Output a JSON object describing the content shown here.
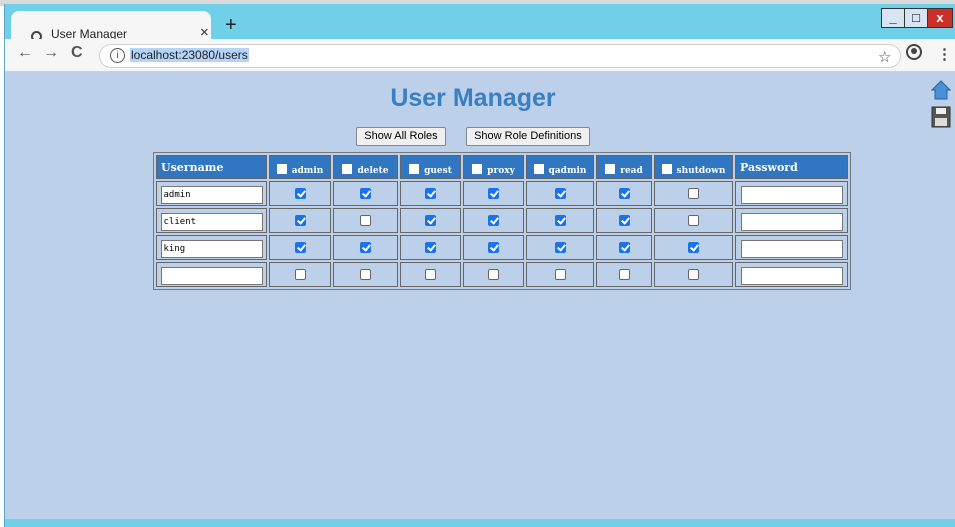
{
  "tab": {
    "title": "User Manager",
    "close": "×",
    "new_tab": "+"
  },
  "window_controls": {
    "minimize": "_",
    "maximize": "□",
    "close": "x"
  },
  "toolbar": {
    "back": "←",
    "forward": "→",
    "reload": "C",
    "url": "localhost:23080/users",
    "info": "i",
    "star": "☆",
    "menu": "⋮"
  },
  "page": {
    "title": "User Manager",
    "buttons": {
      "show_all_roles": "Show All Roles",
      "show_role_definitions": "Show Role Definitions"
    }
  },
  "table": {
    "headers": {
      "username": "Username",
      "password": "Password"
    },
    "roles": [
      "admin",
      "delete",
      "guest",
      "proxy",
      "qadmin",
      "read",
      "shutdown"
    ],
    "rows": [
      {
        "username": "admin",
        "roles": [
          true,
          true,
          true,
          true,
          true,
          true,
          false
        ],
        "password": ""
      },
      {
        "username": "client",
        "roles": [
          true,
          false,
          true,
          true,
          true,
          true,
          false
        ],
        "password": ""
      },
      {
        "username": "king",
        "roles": [
          true,
          true,
          true,
          true,
          true,
          true,
          true
        ],
        "password": ""
      },
      {
        "username": "",
        "roles": [
          false,
          false,
          false,
          false,
          false,
          false,
          false
        ],
        "password": ""
      }
    ]
  },
  "colors": {
    "page_bg": "#bcd0ea",
    "header_bg": "#3176c0",
    "title": "#3a7fc1",
    "chrome": "#70d0ea"
  }
}
